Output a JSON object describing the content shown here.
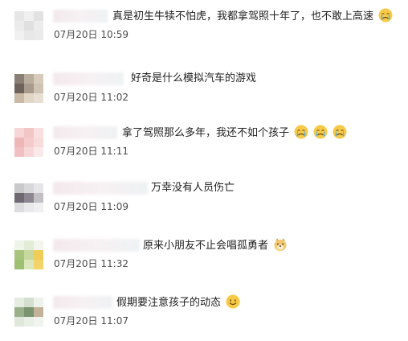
{
  "comments": [
    {
      "text": "真是初生牛犊不怕虎，我都拿驾照十年了，也不敢上高速",
      "date": "07月20日",
      "time": "10:59",
      "emoji": "crying-face"
    },
    {
      "text": "好奇是什么模拟汽车的游戏",
      "date": "07月20日",
      "time": "11:02"
    },
    {
      "text": "拿了驾照那么多年，我还不如个孩子",
      "date": "07月20日",
      "time": "11:11",
      "emoji": "crying-face"
    },
    {
      "text": "万幸没有人员伤亡",
      "date": "07月20日",
      "time": "11:09"
    },
    {
      "text": "原来小朋友不止会唱孤勇者",
      "date": "07月20日",
      "time": "11:32",
      "emoji": "doge-face"
    },
    {
      "text": "假期要注意孩子的动态",
      "date": "07月20日",
      "time": "11:07",
      "emoji": "smiling-face"
    }
  ]
}
